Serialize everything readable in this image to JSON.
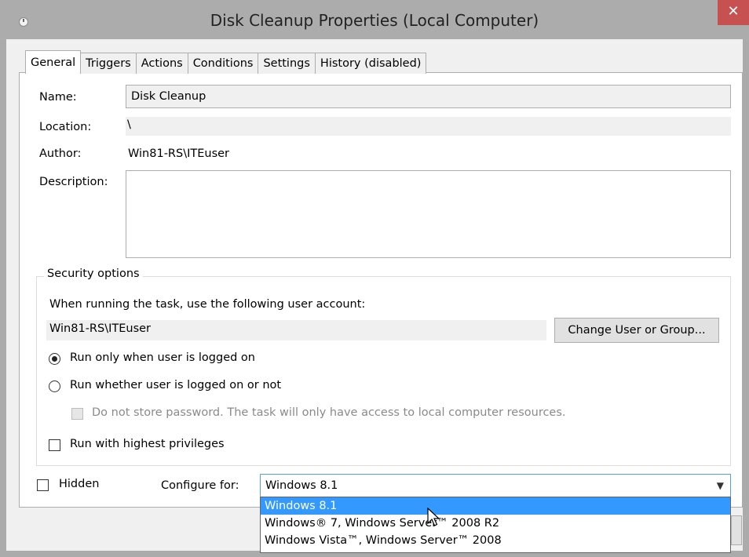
{
  "window": {
    "title": "Disk Cleanup Properties (Local Computer)",
    "close_label": "✕"
  },
  "tabs": [
    {
      "label": "General"
    },
    {
      "label": "Triggers"
    },
    {
      "label": "Actions"
    },
    {
      "label": "Conditions"
    },
    {
      "label": "Settings"
    },
    {
      "label": "History (disabled)"
    }
  ],
  "general": {
    "name_label": "Name:",
    "name_value": "Disk Cleanup",
    "location_label": "Location:",
    "location_value": "\\",
    "author_label": "Author:",
    "author_value": "Win81-RS\\ITEuser",
    "description_label": "Description:",
    "description_value": ""
  },
  "security": {
    "legend": "Security options",
    "account_prompt": "When running the task, use the following user account:",
    "account_value": "Win81-RS\\ITEuser",
    "change_button": "Change User or Group...",
    "radio_logged_on": "Run only when user is logged on",
    "radio_logged_on_checked": true,
    "radio_whether": "Run whether user is logged on or not",
    "radio_whether_checked": false,
    "no_store_password": "Do not store password.  The task will only have access to local computer resources.",
    "highest_privileges": "Run with highest privileges",
    "highest_privileges_checked": false
  },
  "footer": {
    "hidden_label": "Hidden",
    "hidden_checked": false,
    "configure_label": "Configure for:",
    "configure_value": "Windows 8.1",
    "configure_options": [
      "Windows 8.1",
      "Windows® 7, Windows Server™ 2008 R2",
      "Windows Vista™, Windows Server™ 2008"
    ]
  },
  "colors": {
    "selection": "#3399ff",
    "close": "#c75050",
    "focus_border": "#569de5"
  }
}
